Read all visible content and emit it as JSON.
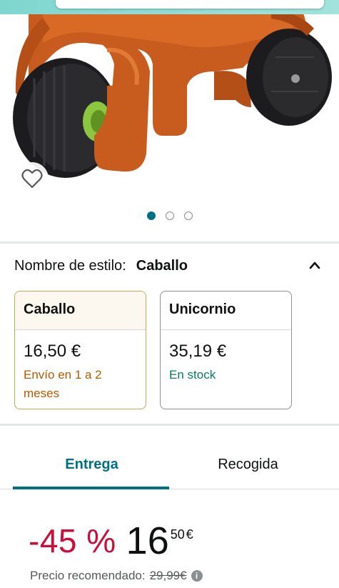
{
  "gallery": {
    "image_alt": "Correpasillos caballo naranja con ruedas negras",
    "dots": [
      "image-1",
      "image-2",
      "image-3"
    ],
    "active_dot": 0
  },
  "style": {
    "label": "Nombre de estilo:",
    "selected": "Caballo",
    "options": [
      {
        "name": "Caballo",
        "price": "16,50 €",
        "availability": "Envío en 1 a 2 meses",
        "availability_color": "#b35a00",
        "selected": true
      },
      {
        "name": "Unicornio",
        "price": "35,19 €",
        "availability": "En stock",
        "availability_color": "#067d62",
        "selected": false
      }
    ]
  },
  "tabs": [
    {
      "label": "Entrega",
      "active": true
    },
    {
      "label": "Recogida",
      "active": false
    }
  ],
  "pricing": {
    "discount": "-45 %",
    "price_whole": "16",
    "price_fraction": "50",
    "currency": "€",
    "rrp_label": "Precio recomendado:",
    "rrp_value": "29,99€"
  },
  "colors": {
    "accent": "#007185",
    "discount": "#cc0c39",
    "selected_border": "#c7a559"
  }
}
